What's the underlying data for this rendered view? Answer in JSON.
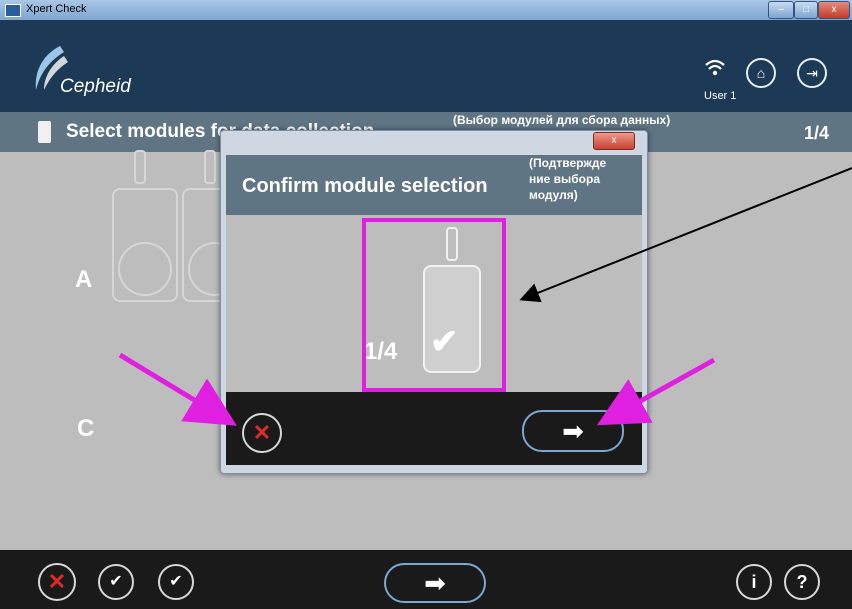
{
  "window": {
    "title": "Xpert Check",
    "controls": {
      "minimize": "–",
      "maximize": "□",
      "close": "x"
    }
  },
  "header": {
    "brand": "Cepheid",
    "user": "User 1",
    "icons": {
      "wifi": "wifi-icon",
      "home": "home-icon",
      "exit": "exit-icon"
    }
  },
  "section": {
    "title": "Select modules for data collection",
    "step": "1/4",
    "annotation": "(Выбор модулей для сбора данных)"
  },
  "grid": {
    "rows": [
      "A",
      "C"
    ]
  },
  "dialog": {
    "title": "Confirm module selection",
    "annotation_lines": [
      "(Подтвержде",
      "ние выбора",
      "модуля)"
    ],
    "module_number": "1/4",
    "close_label": "x",
    "check_glyph": "✔",
    "cancel_glyph": "✕",
    "next_glyph": "➡"
  },
  "bottombar": {
    "cancel_glyph": "✕",
    "accept_one_glyph": "✔",
    "accept_all_glyph": "✔",
    "next_glyph": "➡",
    "info_label": "i",
    "help_label": "?"
  },
  "colors": {
    "header_bg": "#1c3a55",
    "section_bg": "#5f7584",
    "content_bg": "#bdbdbd",
    "footer_bg": "#1a1a1a",
    "annotation": "#e020e0",
    "cancel_red": "#e02a2a",
    "next_outline": "#7aa8d4"
  }
}
